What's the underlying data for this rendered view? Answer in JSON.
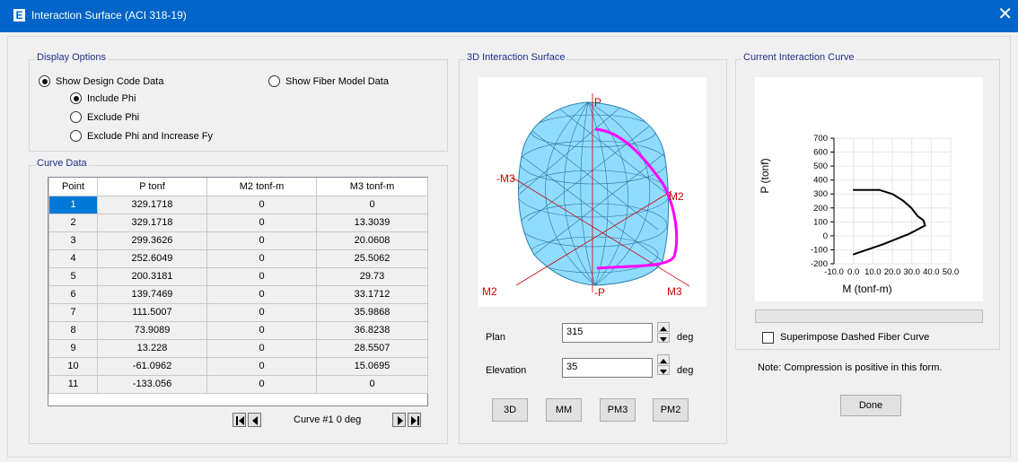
{
  "window": {
    "title": "Interaction Surface (ACI 318-19)",
    "icon_letter": "E",
    "close_glyph": "✕",
    "titlebar_color": "#0064c8"
  },
  "display_options": {
    "title": "Display Options",
    "show_design_code": "Show Design Code Data",
    "show_fiber_model": "Show Fiber Model Data",
    "include_phi": "Include Phi",
    "exclude_phi": "Exclude Phi",
    "exclude_phi_fy": "Exclude Phi and Increase Fy",
    "selected_source": "design_code",
    "selected_phi": "include_phi"
  },
  "curve_data": {
    "title": "Curve Data",
    "columns": [
      "Point",
      "P tonf",
      "M2 tonf-m",
      "M3 tonf-m"
    ],
    "rows": [
      [
        "1",
        "329.1718",
        "0",
        "0"
      ],
      [
        "2",
        "329.1718",
        "0",
        "13.3039"
      ],
      [
        "3",
        "299.3626",
        "0",
        "20.0608"
      ],
      [
        "4",
        "252.6049",
        "0",
        "25.5062"
      ],
      [
        "5",
        "200.3181",
        "0",
        "29.73"
      ],
      [
        "6",
        "139.7469",
        "0",
        "33.1712"
      ],
      [
        "7",
        "111.5007",
        "0",
        "35.9868"
      ],
      [
        "8",
        "73.9089",
        "0",
        "36.8238"
      ],
      [
        "9",
        "13.228",
        "0",
        "28.5507"
      ],
      [
        "10",
        "-61.0962",
        "0",
        "15.0695"
      ],
      [
        "11",
        "-133.056",
        "0",
        "0"
      ]
    ],
    "selected_row": 0,
    "curve_label": "Curve #1  0 deg"
  },
  "surface3d": {
    "title": "3D Interaction Surface",
    "axis_labels": {
      "p_top": "P",
      "p_bottom": "-P",
      "m3_neg": "-M3",
      "m2_right": "M2",
      "m2_left": "M2",
      "m3_right": "M3"
    },
    "plan_label": "Plan",
    "plan_value": "315",
    "elevation_label": "Elevation",
    "elevation_value": "35",
    "deg_unit": "deg",
    "surface_color": "#8fdcff",
    "curve_color": "#ff00ff",
    "axis_color": "#cc0000"
  },
  "view_buttons": [
    "3D",
    "MM",
    "PM3",
    "PM2"
  ],
  "current_curve": {
    "title": "Current Interaction Curve",
    "superimpose_label": "Superimpose Dashed Fiber Curve",
    "superimpose_checked": false,
    "note": "Note:  Compression is positive in this form."
  },
  "done_label": "Done",
  "chart_data": {
    "type": "line",
    "title": "",
    "xlabel": "M (tonf-m)",
    "ylabel": "P (tonf)",
    "xlim": [
      -10,
      50
    ],
    "ylim": [
      -200,
      700
    ],
    "xticks": [
      "-10.0",
      "0.0",
      "10.0",
      "20.0",
      "30.0",
      "40.0",
      "50.0"
    ],
    "yticks": [
      "700",
      "600",
      "500",
      "400",
      "300",
      "200",
      "100",
      "0",
      "-100",
      "-200"
    ],
    "grid": true,
    "series": [
      {
        "x": [
          0,
          13.3039,
          20.0608,
          25.5062,
          29.73,
          33.1712,
          35.9868,
          36.8238,
          28.5507,
          15.0695,
          0
        ],
        "y": [
          329.1718,
          329.1718,
          299.3626,
          252.6049,
          200.3181,
          139.7469,
          111.5007,
          73.9089,
          13.228,
          -61.0962,
          -133.056
        ]
      }
    ]
  }
}
